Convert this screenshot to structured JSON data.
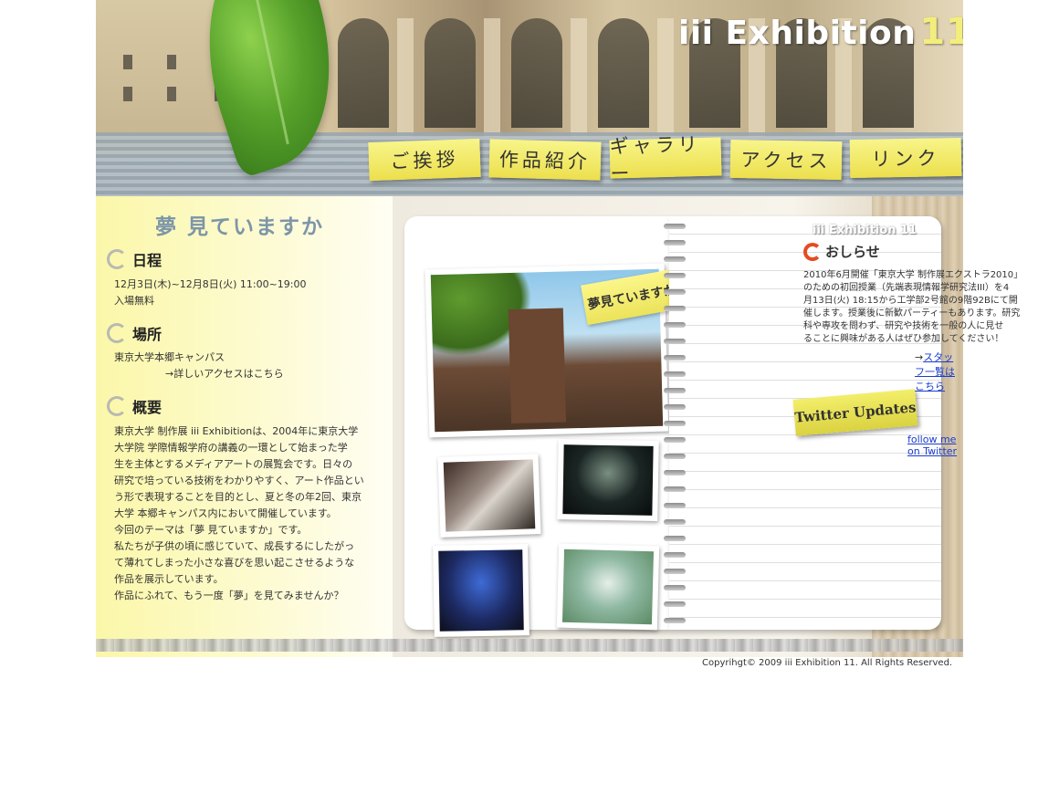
{
  "header": {
    "logo_text": "iii Exhibition",
    "logo_number": "11"
  },
  "nav": {
    "items": [
      {
        "label": "ご挨拶"
      },
      {
        "label": "作品紹介"
      },
      {
        "label": "ギャラリー"
      },
      {
        "label": "アクセス"
      },
      {
        "label": "リンク"
      }
    ]
  },
  "left": {
    "tagline": "夢 見ていますか",
    "schedule": {
      "title": "日程",
      "line1": "12月3日(木)~12月8日(火) 11:00~19:00",
      "line2": "入場無料"
    },
    "place": {
      "title": "場所",
      "line1": "東京大学本郷キャンパス",
      "access_link": "→詳しいアクセスはこちら"
    },
    "overview": {
      "title": "概要",
      "lines": [
        "東京大学 制作展 iii Exhibitionは、2004年に東京大学",
        "大学院 学際情報学府の講義の一環として始まった学",
        "生を主体とするメディアアートの展覧会です。日々の",
        "研究で培っている技術をわかりやすく、アート作品とい",
        "う形で表現することを目的とし、夏と冬の年2回、東京",
        "大学 本郷キャンパス内において開催しています。",
        "今回のテーマは「夢 見ていますか」です。",
        "私たちが子供の頃に感じていて、成長するにしたがっ",
        "て薄れてしまった小さな喜びを思い起こさせるような",
        "作品を展示しています。",
        "作品にふれて、もう一度「夢」を見てみませんか？"
      ]
    }
  },
  "notebook": {
    "brand": "iii Exhibition 11",
    "photo_note": "夢見ていますか？",
    "news_title": "おしらせ",
    "news_lines": [
      "2010年6月開催「東京大学 制作展エクストラ2010」",
      "のための初回授業（先端表現情報学研究法III）を4",
      "月13日(火) 18:15から工学部2号館の9階92Bにて開",
      "催します。授業後に新歓パーティーもあります。研究",
      "科や専攻を問わず、研究や技術を一般の人に見せ",
      "ることに興味がある人はぜひ参加してください！"
    ],
    "staff_arrow": "→",
    "staff_link": "スタッフ一覧はこちら",
    "twitter_badge": "Twitter Updates",
    "twitter_link": "follow me on Twitter"
  },
  "footer": {
    "copyright": "Copyrihgt© 2009 iii Exhibition 11. All Rights Reserved."
  }
}
